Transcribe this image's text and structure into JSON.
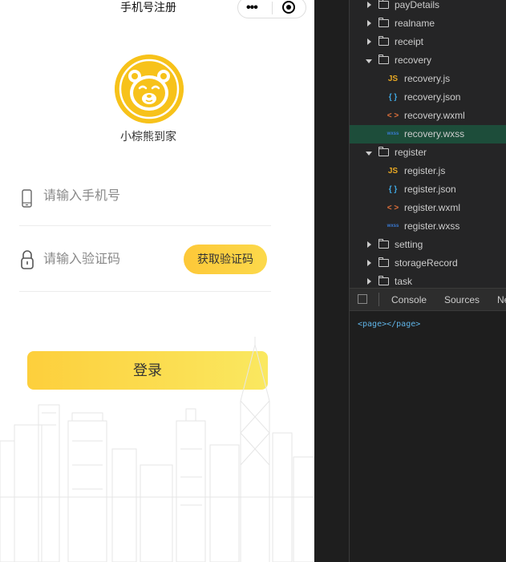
{
  "phone": {
    "nav_title": "手机号注册",
    "capsule_menu": "•••",
    "brand": "小棕熊到家",
    "phone_placeholder": "请输入手机号",
    "code_placeholder": "请输入验证码",
    "get_code_label": "获取验证码",
    "login_label": "登录",
    "accent_color": "#fdcf3c"
  },
  "file_tree": [
    {
      "label": "payDetails",
      "type": "folder",
      "expanded": false
    },
    {
      "label": "realname",
      "type": "folder",
      "expanded": false
    },
    {
      "label": "receipt",
      "type": "folder",
      "expanded": false
    },
    {
      "label": "recovery",
      "type": "folder",
      "expanded": true
    },
    {
      "label": "recovery.js",
      "type": "js",
      "icon": "JS"
    },
    {
      "label": "recovery.json",
      "type": "json",
      "icon": "{ }"
    },
    {
      "label": "recovery.wxml",
      "type": "wxml",
      "icon": "< >"
    },
    {
      "label": "recovery.wxss",
      "type": "wxss",
      "icon": "wxss",
      "selected": true
    },
    {
      "label": "register",
      "type": "folder",
      "expanded": true
    },
    {
      "label": "register.js",
      "type": "js",
      "icon": "JS"
    },
    {
      "label": "register.json",
      "type": "json",
      "icon": "{ }"
    },
    {
      "label": "register.wxml",
      "type": "wxml",
      "icon": "< >"
    },
    {
      "label": "register.wxss",
      "type": "wxss",
      "icon": "wxss"
    },
    {
      "label": "setting",
      "type": "folder",
      "expanded": false
    },
    {
      "label": "storageRecord",
      "type": "folder",
      "expanded": false
    },
    {
      "label": "task",
      "type": "folder",
      "expanded": false
    }
  ],
  "devtools": {
    "tabs": [
      "Console",
      "Sources",
      "Ne"
    ],
    "console_output": "<page></page>"
  },
  "colors": {
    "js_icon": "#e8a823",
    "json_icon": "#3fa6e0",
    "wxml_icon": "#e0703a",
    "wxss_icon": "#3a7bd5",
    "selected_bg": "#1d4d3a"
  }
}
